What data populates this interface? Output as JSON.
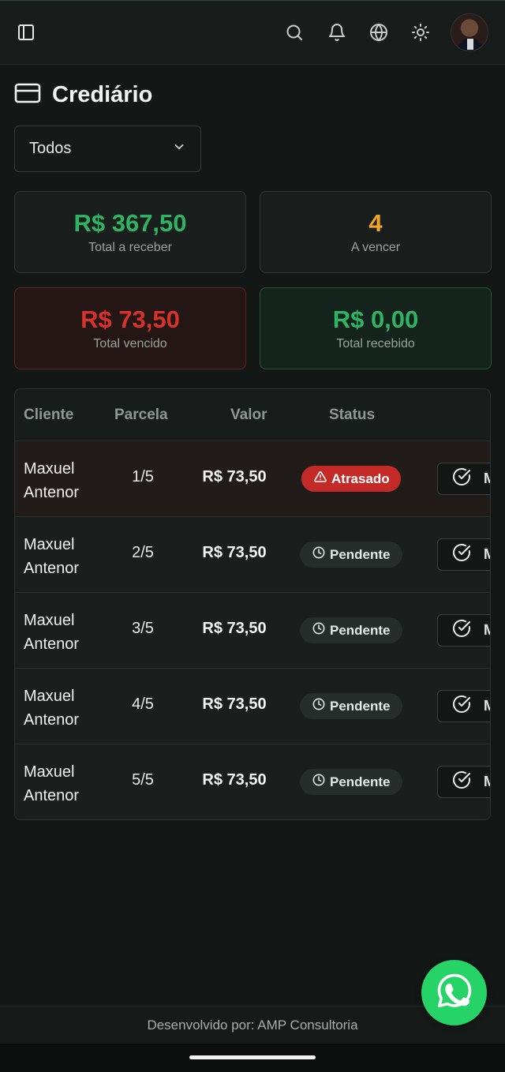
{
  "header": {
    "sidebar_toggle_icon": "panel-left-icon",
    "icons": [
      "search-icon",
      "bell-icon",
      "globe-icon",
      "sun-icon"
    ]
  },
  "page": {
    "title": "Crediário",
    "title_icon": "credit-card-icon"
  },
  "filter": {
    "selected": "Todos"
  },
  "summary": [
    {
      "value": "R$ 367,50",
      "label": "Total a receber",
      "color": "#2fb463"
    },
    {
      "value": "4",
      "label": "A vencer",
      "color": "#f0a526"
    },
    {
      "value": "R$ 73,50",
      "label": "Total vencido",
      "color": "#d8322b"
    },
    {
      "value": "R$ 0,00",
      "label": "Total recebido",
      "color": "#2fb463"
    }
  ],
  "table": {
    "columns": [
      "Cliente",
      "Parcela",
      "Valor",
      "Status"
    ],
    "rows": [
      {
        "cliente": "Maxuel Antenor",
        "parcela": "1/5",
        "valor": "R$ 73,50",
        "status": "Atrasado",
        "action": "M"
      },
      {
        "cliente": "Maxuel Antenor",
        "parcela": "2/5",
        "valor": "R$ 73,50",
        "status": "Pendente",
        "action": "M"
      },
      {
        "cliente": "Maxuel Antenor",
        "parcela": "3/5",
        "valor": "R$ 73,50",
        "status": "Pendente",
        "action": "M"
      },
      {
        "cliente": "Maxuel Antenor",
        "parcela": "4/5",
        "valor": "R$ 73,50",
        "status": "Pendente",
        "action": "M"
      },
      {
        "cliente": "Maxuel Antenor",
        "parcela": "5/5",
        "valor": "R$ 73,50",
        "status": "Pendente",
        "action": "M"
      }
    ]
  },
  "footer": {
    "text": "Desenvolvido por: AMP Consultoria"
  },
  "fab": {
    "icon": "whatsapp-icon",
    "color": "#25d366"
  }
}
